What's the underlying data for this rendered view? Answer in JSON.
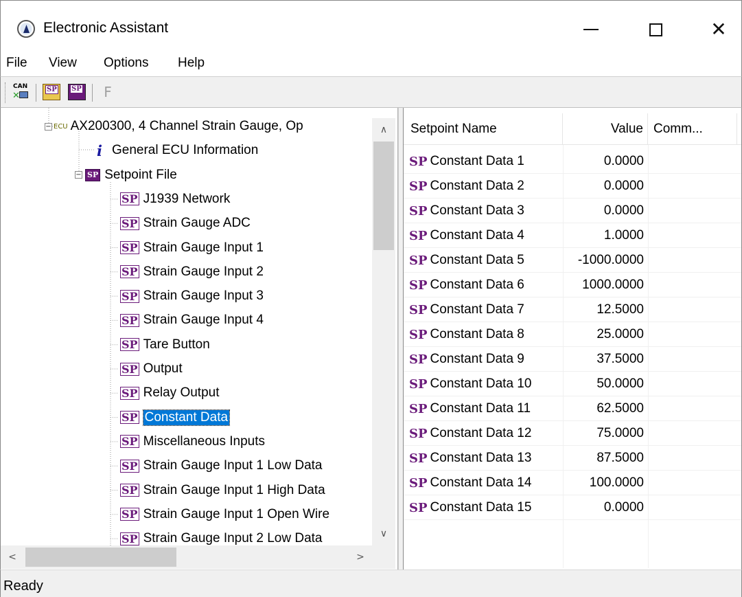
{
  "window": {
    "title": "Electronic Assistant",
    "min_glyph": "—",
    "max_glyph": "☐",
    "close_glyph": "✕"
  },
  "menu": [
    "File",
    "View",
    "Options",
    "Help"
  ],
  "toolbar": {
    "can_label": "CAN",
    "sp_label": "SP",
    "f_label": "F",
    "icons": [
      "can-connect-icon",
      "open-setpoint-icon",
      "save-setpoint-icon",
      "flash-icon"
    ]
  },
  "tree": {
    "ecu_tag": "ECU",
    "ecu_label": "AX200300, 4 Channel Strain Gauge, Op",
    "info_tag": "i",
    "info_label": "General ECU Information",
    "sp_file_tag": "SP",
    "sp_file_label": "Setpoint File",
    "sp_tag": "SP",
    "items": [
      "J1939 Network",
      "Strain Gauge ADC",
      "Strain Gauge Input 1",
      "Strain Gauge Input 2",
      "Strain Gauge Input 3",
      "Strain Gauge Input 4",
      "Tare Button",
      "Output",
      "Relay Output",
      "Constant Data",
      "Miscellaneous Inputs",
      "Strain Gauge Input 1 Low Data",
      "Strain Gauge Input 1 High Data",
      "Strain Gauge Input 1 Open Wire",
      "Strain Gauge Input 2 Low Data"
    ],
    "selected": "Constant Data",
    "collapse_glyph": "−",
    "scroll_up": "∧",
    "scroll_down": "∨",
    "scroll_left": "<",
    "scroll_right": ">"
  },
  "list": {
    "columns": [
      "Setpoint Name",
      "Value",
      "Comm..."
    ],
    "sp_tag": "SP",
    "rows": [
      {
        "name": "Constant Data 1",
        "value": "0.0000"
      },
      {
        "name": "Constant Data 2",
        "value": "0.0000"
      },
      {
        "name": "Constant Data 3",
        "value": "0.0000"
      },
      {
        "name": "Constant Data 4",
        "value": "1.0000"
      },
      {
        "name": "Constant Data 5",
        "value": "-1000.0000"
      },
      {
        "name": "Constant Data 6",
        "value": "1000.0000"
      },
      {
        "name": "Constant Data 7",
        "value": "12.5000"
      },
      {
        "name": "Constant Data 8",
        "value": "25.0000"
      },
      {
        "name": "Constant Data 9",
        "value": "37.5000"
      },
      {
        "name": "Constant Data 10",
        "value": "50.0000"
      },
      {
        "name": "Constant Data 11",
        "value": "62.5000"
      },
      {
        "name": "Constant Data 12",
        "value": "75.0000"
      },
      {
        "name": "Constant Data 13",
        "value": "87.5000"
      },
      {
        "name": "Constant Data 14",
        "value": "100.0000"
      },
      {
        "name": "Constant Data 15",
        "value": "0.0000"
      }
    ]
  },
  "status": {
    "text": "Ready"
  },
  "colors": {
    "selection": "#0078d7",
    "sp_purple": "#6a1a7a",
    "info_blue": "#1a1aa0"
  }
}
